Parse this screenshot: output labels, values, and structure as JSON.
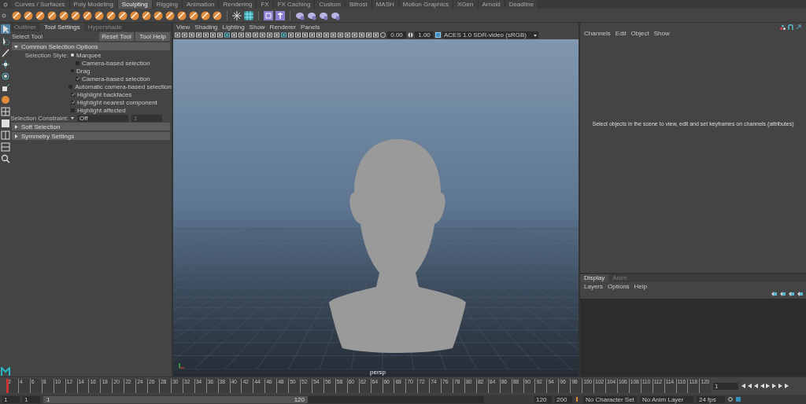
{
  "shelf_tabs": [
    {
      "label": "Curves / Surfaces",
      "selected": false
    },
    {
      "label": "Poly Modeling",
      "selected": false
    },
    {
      "label": "Sculpting",
      "selected": true
    },
    {
      "label": "Rigging",
      "selected": false
    },
    {
      "label": "Animation",
      "selected": false
    },
    {
      "label": "Rendering",
      "selected": false
    },
    {
      "label": "FX",
      "selected": false
    },
    {
      "label": "FX Caching",
      "selected": false
    },
    {
      "label": "Custom",
      "selected": false
    },
    {
      "label": "Bifrost",
      "selected": false
    },
    {
      "label": "MASH",
      "selected": false
    },
    {
      "label": "Motion Graphics",
      "selected": false
    },
    {
      "label": "XGen",
      "selected": false
    },
    {
      "label": "Arnold",
      "selected": false
    },
    {
      "label": "Deadline",
      "selected": false
    }
  ],
  "panel_tabs": [
    {
      "label": "Outliner",
      "selected": false
    },
    {
      "label": "Tool Settings",
      "selected": true
    },
    {
      "label": "Hypershade",
      "selected": false
    }
  ],
  "tool": {
    "title": "Select Tool",
    "buttons": [
      "Reset Tool",
      "Tool Help"
    ]
  },
  "sections": [
    {
      "title": "Common Selection Options",
      "expanded": true,
      "rows": [
        {
          "kind": "radio",
          "label": "Selection Style:",
          "text": "Marquee",
          "selected": true
        },
        {
          "kind": "sub_checkbox",
          "text": "Camera-based selection",
          "checked": false
        },
        {
          "kind": "radio",
          "text": "Drag",
          "selected": false
        },
        {
          "kind": "sub_checkbox",
          "text": "Camera-based selection",
          "checked": true
        },
        {
          "kind": "checkbox",
          "text": "Automatic camera-based selection",
          "checked": false
        },
        {
          "kind": "checkbox",
          "text": "Highlight backfaces",
          "checked": true
        },
        {
          "kind": "checkbox",
          "text": "Highlight nearest component",
          "checked": true
        },
        {
          "kind": "checkbox",
          "text": "Highlight affected",
          "checked": false
        },
        {
          "kind": "dropdown",
          "label": "Selection Constraint:",
          "value": "Off",
          "extra": "1"
        }
      ]
    },
    {
      "title": "Soft Selection",
      "expanded": false
    },
    {
      "title": "Symmetry Settings",
      "expanded": false
    }
  ],
  "viewport": {
    "menus": [
      "View",
      "Shading",
      "Lighting",
      "Show",
      "Renderer",
      "Panels"
    ],
    "exposure": "0.00",
    "gamma": "1.00",
    "colorspace": "ACES 1.0 SDR-video (sRGB)",
    "camera": "persp"
  },
  "channel_box": {
    "menus": [
      "Channels",
      "Edit",
      "Object",
      "Show"
    ],
    "message": "Select objects in the scene to view, edit and set keyframes on channels (attributes)"
  },
  "layer_editor": {
    "tabs": [
      {
        "label": "Display",
        "selected": true
      },
      {
        "label": "Anim",
        "selected": false
      }
    ],
    "menus": [
      "Layers",
      "Options",
      "Help"
    ]
  },
  "timeline": {
    "ticks": [
      "2",
      "4",
      "6",
      "8",
      "10",
      "12",
      "14",
      "16",
      "18",
      "20",
      "22",
      "24",
      "26",
      "28",
      "30",
      "32",
      "34",
      "36",
      "38",
      "40",
      "42",
      "44",
      "46",
      "48",
      "50",
      "52",
      "54",
      "56",
      "58",
      "60",
      "62",
      "64",
      "66",
      "68",
      "70",
      "72",
      "74",
      "76",
      "78",
      "80",
      "82",
      "84",
      "86",
      "88",
      "90",
      "92",
      "94",
      "96",
      "98",
      "100",
      "102",
      "104",
      "106",
      "108",
      "110",
      "112",
      "114",
      "116",
      "118",
      "120"
    ],
    "current_frame": "1",
    "level": 0
  },
  "range": {
    "start": "1",
    "playback_start": "1",
    "slider_start": "1",
    "slider_end": "120",
    "playback_end": "120",
    "end": "200",
    "character_set": "No Character Set",
    "anim_layer": "No Anim Layer",
    "fps": "24 fps",
    "level": 0.6
  }
}
